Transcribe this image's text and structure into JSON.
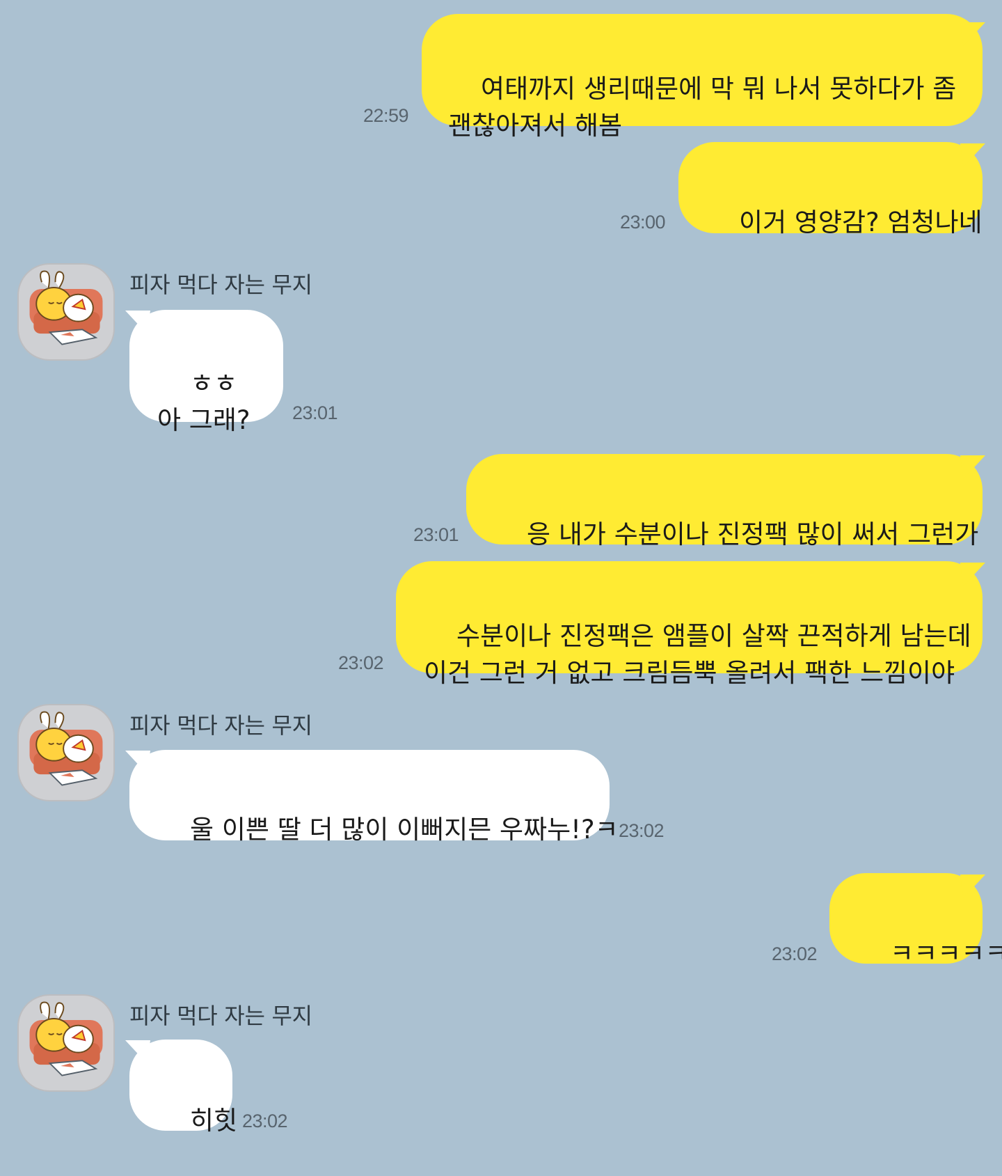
{
  "chat": {
    "contact_name": "피자 먹다 자는 무지",
    "avatar_icon": "muzi-pizza-sofa-icon",
    "colors": {
      "background": "#abc1d1",
      "my_bubble": "#ffeb33",
      "their_bubble": "#ffffff"
    },
    "messages": [
      {
        "sender": "me",
        "text": "여태까지 생리때문에 막 뭐 나서 못하다가 좀\n괜찮아져서 해봄",
        "time": "22:59"
      },
      {
        "sender": "me",
        "text": "이거 영양감? 엄청나네",
        "time": "23:00"
      },
      {
        "sender": "other",
        "name": "피자 먹다 자는 무지",
        "text": "ㅎㅎ\n아 그래?",
        "time": "23:01"
      },
      {
        "sender": "me",
        "text": "응 내가 수분이나 진정팩 많이 써서 그런가",
        "time": "23:01"
      },
      {
        "sender": "me",
        "text": "수분이나 진정팩은 앰플이 살짝 끈적하게 남는데\n이건 그런 거 없고 크림듬뿍 올려서 팩한 느낌이야",
        "time": "23:02"
      },
      {
        "sender": "other",
        "name": "피자 먹다 자는 무지",
        "text": "울 이쁜 딸 더 많이 이뻐지믄 우짜누!?ㅋ",
        "time": "23:02"
      },
      {
        "sender": "me",
        "text": "ㅋㅋㅋㅋㅋ",
        "time": "23:02"
      },
      {
        "sender": "other",
        "name": "피자 먹다 자는 무지",
        "text": "히힛",
        "time": "23:02"
      }
    ]
  }
}
